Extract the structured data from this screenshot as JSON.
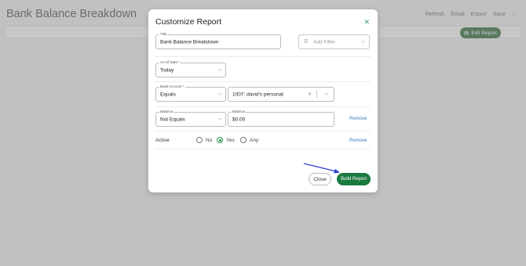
{
  "page": {
    "title": "Bank Balance Breakdown",
    "actions": [
      "Refresh",
      "Email",
      "Export",
      "Save"
    ],
    "edit_report_label": "Edit Report"
  },
  "modal": {
    "title": "Customize Report",
    "title_field": {
      "label": "Title",
      "value": "Bank Balance Breakdown"
    },
    "add_filter_placeholder": "Add Filter",
    "as_of_date": {
      "label": "As Of Date *",
      "value": "Today"
    },
    "bank_account": {
      "label": "Bank Account *",
      "operator": "Equals",
      "value": "1007: david's personal"
    },
    "balance": {
      "label": "Balance",
      "operator": "Not Equals",
      "value_label": "Balance",
      "value": "$0.00"
    },
    "active": {
      "label": "Active",
      "options": [
        "No",
        "Yes",
        "Any"
      ],
      "selected": "Yes"
    },
    "remove_label": "Remove",
    "close_label": "Close",
    "build_label": "Build Report"
  },
  "icons": {
    "close": "close-icon",
    "filter": "filter-icon",
    "chevron": "chevron-down-icon",
    "clear": "clear-icon",
    "heart": "heart-icon",
    "document": "document-icon"
  },
  "colors": {
    "accent": "#1b7a3e",
    "link": "#3b7bbf",
    "annotation_arrow": "#2a3fd1"
  }
}
